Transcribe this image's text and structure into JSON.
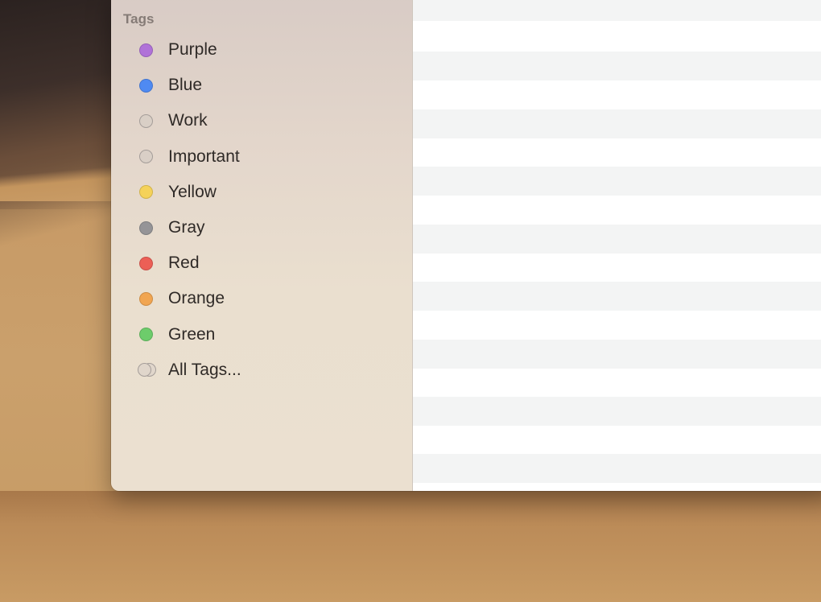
{
  "sidebar": {
    "section_title": "Tags",
    "tags": [
      {
        "label": "Purple",
        "color": "#b072d8",
        "icon": "purple-tag-dot-icon"
      },
      {
        "label": "Blue",
        "color": "#4f8af2",
        "icon": "blue-tag-dot-icon"
      },
      {
        "label": "Work",
        "color": "",
        "icon": "empty-tag-circle-icon"
      },
      {
        "label": "Important",
        "color": "",
        "icon": "empty-tag-circle-icon"
      },
      {
        "label": "Yellow",
        "color": "#f5d25a",
        "icon": "yellow-tag-dot-icon"
      },
      {
        "label": "Gray",
        "color": "#959497",
        "icon": "gray-tag-dot-icon"
      },
      {
        "label": "Red",
        "color": "#ec5f56",
        "icon": "red-tag-dot-icon"
      },
      {
        "label": "Orange",
        "color": "#f1a551",
        "icon": "orange-tag-dot-icon"
      },
      {
        "label": "Green",
        "color": "#6dcc6b",
        "icon": "green-tag-dot-icon"
      }
    ],
    "all_tags_label": "All Tags..."
  }
}
